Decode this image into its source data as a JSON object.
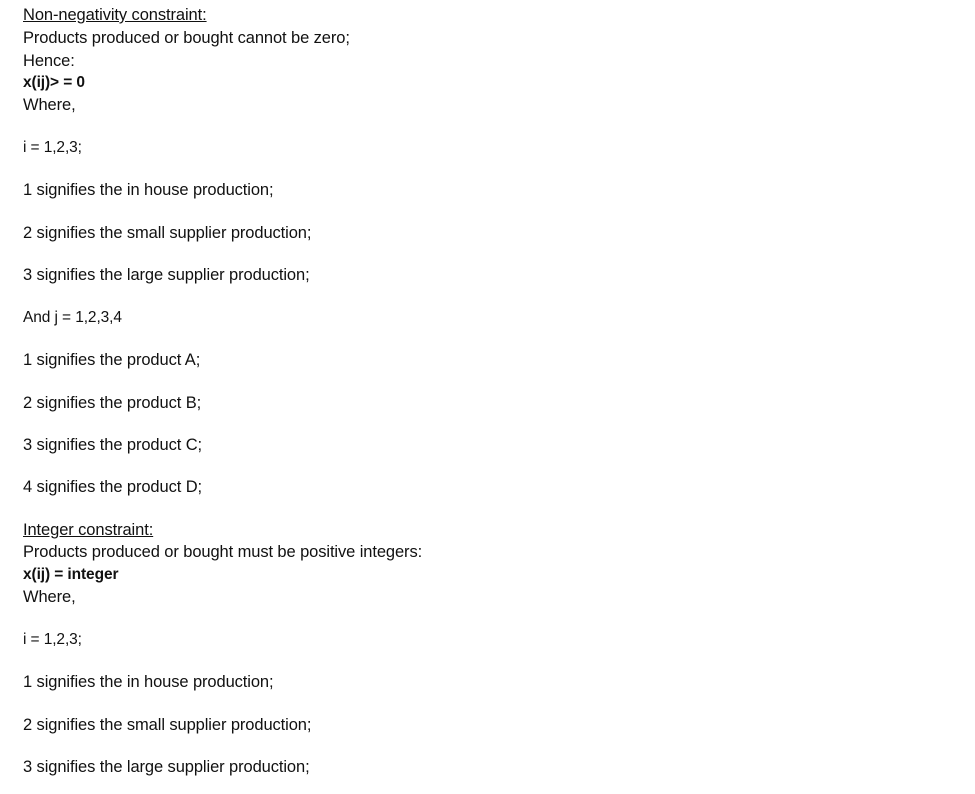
{
  "nonneg": {
    "heading": "Non-negativity constraint:",
    "desc": "Products produced or bought cannot be zero;",
    "hence": "Hence:",
    "formula": "x(ij)> = 0",
    "where": "Where,",
    "i_def": "i = 1,2,3;",
    "i_items": [
      "1 signifies the in house production;",
      "2 signifies the small supplier production;",
      "3 signifies the large supplier production;"
    ],
    "j_def": "And j = 1,2,3,4",
    "j_items": [
      "1 signifies the product A;",
      "2 signifies the product B;",
      "3 signifies the product C;",
      "4 signifies the product D;"
    ]
  },
  "integer": {
    "heading": "Integer constraint:",
    "desc": "Products produced or bought must be positive integers:",
    "formula": "x(ij) = integer",
    "where": "Where,",
    "i_def": "i = 1,2,3;",
    "i_items": [
      "1 signifies the in house production;",
      "2 signifies the small supplier production;",
      "3 signifies the large supplier production;"
    ]
  }
}
